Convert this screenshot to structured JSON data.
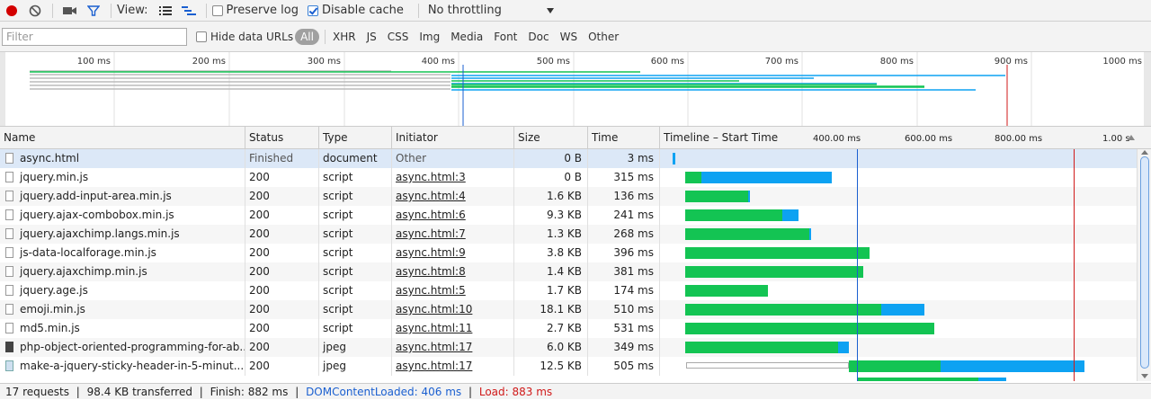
{
  "toolbar": {
    "record_icon": "record-icon",
    "clear_icon": "clear-icon",
    "camera_icon": "camera-icon",
    "filter_icon": "filter-icon",
    "view_label": "View:",
    "preserve_log_label": "Preserve log",
    "preserve_log_checked": false,
    "disable_cache_label": "Disable cache",
    "disable_cache_checked": true,
    "throttling_value": "No throttling",
    "colors": {
      "record": "#d30000",
      "accent": "#1a5fd0"
    }
  },
  "filterbar": {
    "placeholder": "Filter",
    "hide_data_urls_label": "Hide data URLs",
    "types": [
      "All",
      "XHR",
      "JS",
      "CSS",
      "Img",
      "Media",
      "Font",
      "Doc",
      "WS",
      "Other"
    ]
  },
  "overview": {
    "ticks": [
      "100 ms",
      "200 ms",
      "300 ms",
      "400 ms",
      "500 ms",
      "600 ms",
      "700 ms",
      "800 ms",
      "900 ms",
      "1000 ms"
    ]
  },
  "columns": [
    "Name",
    "Status",
    "Type",
    "Initiator",
    "Size",
    "Time",
    "Timeline – Start Time"
  ],
  "timeline_ticks": [
    "400.00 ms",
    "600.00 ms",
    "800.00 ms",
    "1.00 s"
  ],
  "colors": {
    "waiting": "#13c453",
    "receiving": "#0da2f2",
    "dom_line": "#1a5fd0",
    "load_line": "#d01a1a"
  },
  "rows": [
    {
      "name": "async.html",
      "status": "Finished",
      "type": "document",
      "initiator": "Other",
      "size": "0 B",
      "time": "3 ms",
      "icon": "doc"
    },
    {
      "name": "jquery.min.js",
      "status": "200",
      "type": "script",
      "initiator": "async.html:3",
      "size": "0 B",
      "time": "315 ms",
      "icon": "doc"
    },
    {
      "name": "jquery.add-input-area.min.js",
      "status": "200",
      "type": "script",
      "initiator": "async.html:4",
      "size": "1.6 KB",
      "time": "136 ms",
      "icon": "doc"
    },
    {
      "name": "jquery.ajax-combobox.min.js",
      "status": "200",
      "type": "script",
      "initiator": "async.html:6",
      "size": "9.3 KB",
      "time": "241 ms",
      "icon": "doc"
    },
    {
      "name": "jquery.ajaxchimp.langs.min.js",
      "status": "200",
      "type": "script",
      "initiator": "async.html:7",
      "size": "1.3 KB",
      "time": "268 ms",
      "icon": "doc"
    },
    {
      "name": "js-data-localforage.min.js",
      "status": "200",
      "type": "script",
      "initiator": "async.html:9",
      "size": "3.8 KB",
      "time": "396 ms",
      "icon": "doc"
    },
    {
      "name": "jquery.ajaxchimp.min.js",
      "status": "200",
      "type": "script",
      "initiator": "async.html:8",
      "size": "1.4 KB",
      "time": "381 ms",
      "icon": "doc"
    },
    {
      "name": "jquery.age.js",
      "status": "200",
      "type": "script",
      "initiator": "async.html:5",
      "size": "1.7 KB",
      "time": "174 ms",
      "icon": "doc"
    },
    {
      "name": "emoji.min.js",
      "status": "200",
      "type": "script",
      "initiator": "async.html:10",
      "size": "18.1 KB",
      "time": "510 ms",
      "icon": "doc"
    },
    {
      "name": "md5.min.js",
      "status": "200",
      "type": "script",
      "initiator": "async.html:11",
      "size": "2.7 KB",
      "time": "531 ms",
      "icon": "doc"
    },
    {
      "name": "php-object-oriented-programming-for-ab...",
      "status": "200",
      "type": "jpeg",
      "initiator": "async.html:17",
      "size": "6.0 KB",
      "time": "349 ms",
      "icon": "img"
    },
    {
      "name": "make-a-jquery-sticky-header-in-5-minut...",
      "status": "200",
      "type": "jpeg",
      "initiator": "async.html:17",
      "size": "12.5 KB",
      "time": "505 ms",
      "icon": "img2"
    }
  ],
  "status": {
    "requests": "17 requests",
    "transferred": "98.4 KB transferred",
    "finish": "Finish: 882 ms",
    "dom_content_loaded": "DOMContentLoaded: 406 ms",
    "load": "Load: 883 ms",
    "separator": "|"
  }
}
